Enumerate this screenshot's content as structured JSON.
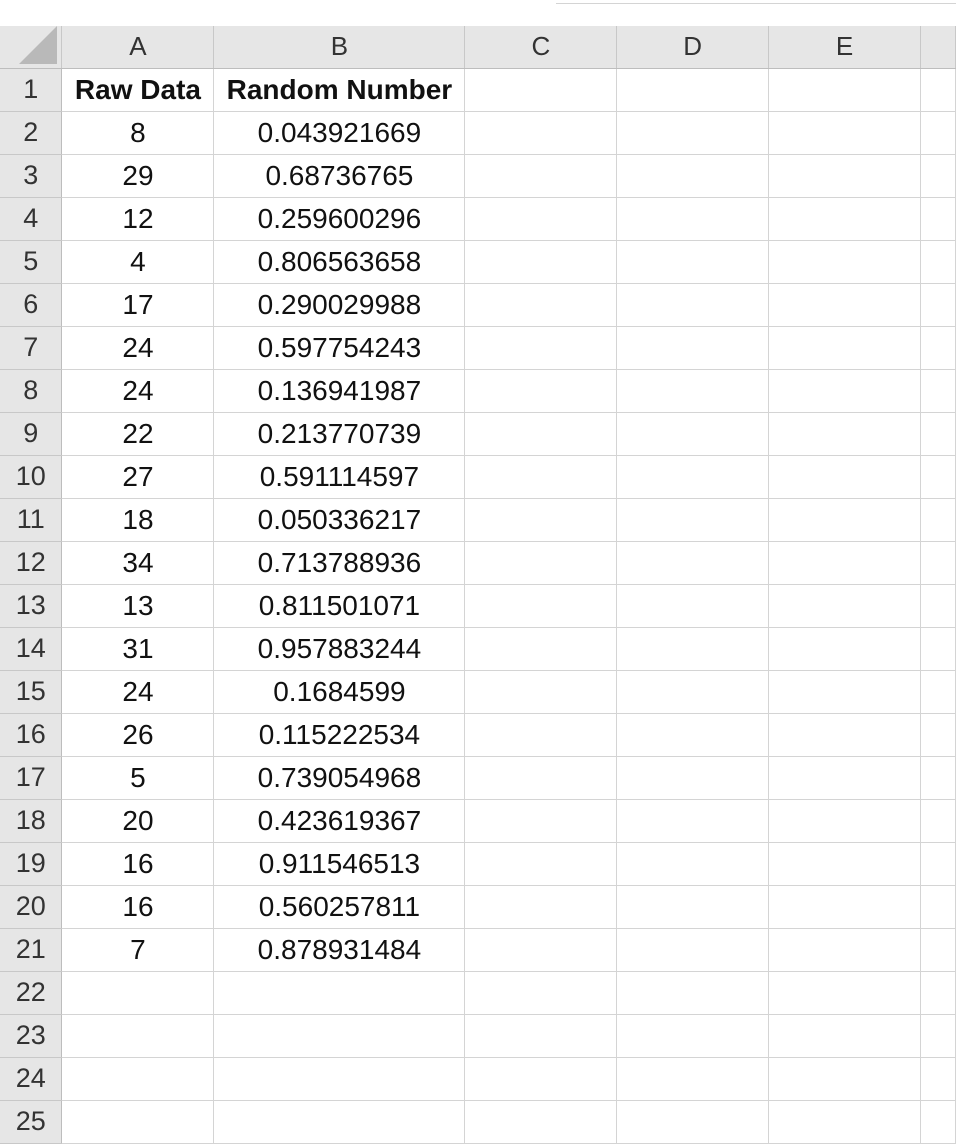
{
  "columns": [
    "A",
    "B",
    "C",
    "D",
    "E"
  ],
  "rows": [
    {
      "num": "1",
      "a": "Raw Data",
      "b": "Random Number"
    },
    {
      "num": "2",
      "a": "8",
      "b": "0.043921669"
    },
    {
      "num": "3",
      "a": "29",
      "b": "0.68736765"
    },
    {
      "num": "4",
      "a": "12",
      "b": "0.259600296"
    },
    {
      "num": "5",
      "a": "4",
      "b": "0.806563658"
    },
    {
      "num": "6",
      "a": "17",
      "b": "0.290029988"
    },
    {
      "num": "7",
      "a": "24",
      "b": "0.597754243"
    },
    {
      "num": "8",
      "a": "24",
      "b": "0.136941987"
    },
    {
      "num": "9",
      "a": "22",
      "b": "0.213770739"
    },
    {
      "num": "10",
      "a": "27",
      "b": "0.591114597"
    },
    {
      "num": "11",
      "a": "18",
      "b": "0.050336217"
    },
    {
      "num": "12",
      "a": "34",
      "b": "0.713788936"
    },
    {
      "num": "13",
      "a": "13",
      "b": "0.811501071"
    },
    {
      "num": "14",
      "a": "31",
      "b": "0.957883244"
    },
    {
      "num": "15",
      "a": "24",
      "b": "0.1684599"
    },
    {
      "num": "16",
      "a": "26",
      "b": "0.115222534"
    },
    {
      "num": "17",
      "a": "5",
      "b": "0.739054968"
    },
    {
      "num": "18",
      "a": "20",
      "b": "0.423619367"
    },
    {
      "num": "19",
      "a": "16",
      "b": "0.911546513"
    },
    {
      "num": "20",
      "a": "16",
      "b": "0.560257811"
    },
    {
      "num": "21",
      "a": "7",
      "b": "0.878931484"
    },
    {
      "num": "22",
      "a": "",
      "b": ""
    },
    {
      "num": "23",
      "a": "",
      "b": ""
    },
    {
      "num": "24",
      "a": "",
      "b": ""
    },
    {
      "num": "25",
      "a": "",
      "b": ""
    }
  ]
}
